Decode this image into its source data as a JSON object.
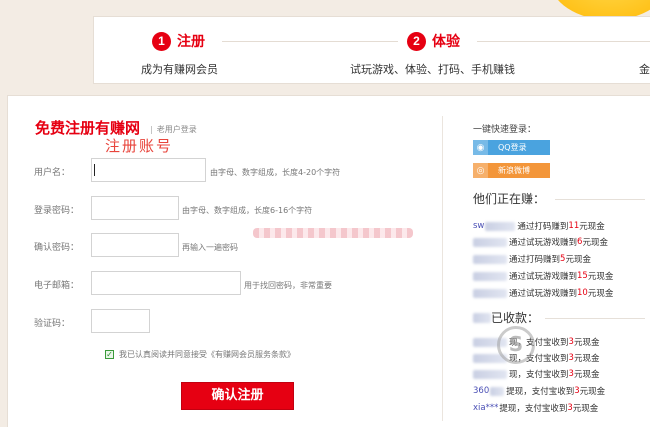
{
  "steps": [
    {
      "num": "1",
      "title": "注册",
      "desc": "成为有赚网会员"
    },
    {
      "num": "2",
      "title": "体验",
      "desc": "试玩游戏、体验、打码、手机赚钱"
    },
    {
      "desc_partial": "金"
    }
  ],
  "form": {
    "title": "免费注册有赚网",
    "separator": "|",
    "old_user_login": "老用户登录",
    "overlay_text": "注册账号",
    "fields": [
      {
        "label": "用户名：",
        "hint": "由字母、数字组成，长度4-20个字符"
      },
      {
        "label": "登录密码：",
        "hint": "由字母、数字组成，长度6-16个字符"
      },
      {
        "label": "确认密码：",
        "hint": "再输入一遍密码"
      },
      {
        "label": "电子邮箱：",
        "hint": "用于找回密码，非常重要"
      },
      {
        "label": "验证码：",
        "hint": ""
      }
    ],
    "agree_check": "✓",
    "agree_text": "我已认真阅读并同意接受《有赚网会员服务条款》",
    "submit_label": "确认注册"
  },
  "side": {
    "quick_login_title": "一键快速登录：",
    "qq_label": "QQ登录",
    "weibo_label": "新浪微博",
    "earning_title": "他们正在赚：",
    "earning_items": [
      {
        "name": "sw",
        "text": "通过打码赚到",
        "amount": "11",
        "unit": "元现金"
      },
      {
        "name": "",
        "text": "通过试玩游戏赚到",
        "amount": "6",
        "unit": "元现金"
      },
      {
        "name": "",
        "text": "通过打码赚到",
        "amount": "5",
        "unit": "元现金"
      },
      {
        "name": "",
        "text": "通过试玩游戏赚到",
        "amount": "15",
        "unit": "元现金"
      },
      {
        "name": "",
        "text": "通过试玩游戏赚到",
        "amount": "10",
        "unit": "元现金"
      }
    ],
    "received_title": "已收款：",
    "received_items": [
      {
        "name": "",
        "text": "现，支付宝收到",
        "amount": "3",
        "unit": "元现金"
      },
      {
        "name": "",
        "text": "现，支付宝收到",
        "amount": "3",
        "unit": "元现金"
      },
      {
        "name": "",
        "text": "现，支付宝收到",
        "amount": "3",
        "unit": "元现金"
      },
      {
        "name": "360",
        "text": "提现，支付宝收到",
        "amount": "3",
        "unit": "元现金"
      },
      {
        "name": "xia***",
        "text": "提现，支付宝收到",
        "amount": "3",
        "unit": "元现金"
      }
    ],
    "watermark_letter": "S"
  },
  "colors": {
    "accent": "#e60012",
    "qq": "#4aa3df",
    "weibo": "#f3963a"
  }
}
